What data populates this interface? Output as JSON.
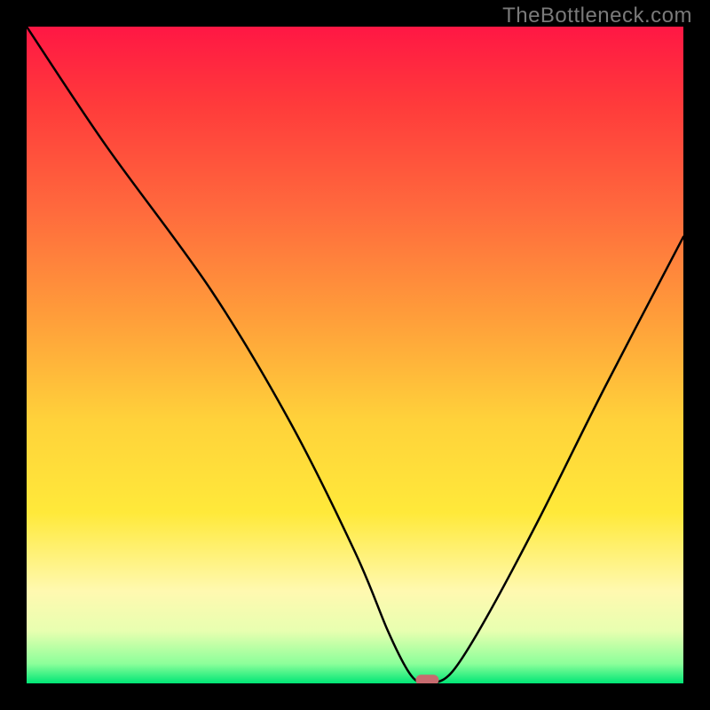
{
  "watermark": "TheBottleneck.com",
  "chart_data": {
    "type": "line",
    "title": "",
    "xlabel": "",
    "ylabel": "",
    "xlim": [
      0,
      100
    ],
    "ylim": [
      0,
      100
    ],
    "series": [
      {
        "name": "bottleneck-curve",
        "x": [
          0,
          12,
          28,
          40,
          50,
          55,
          58,
          60,
          62,
          65,
          70,
          78,
          88,
          100
        ],
        "values": [
          100,
          82,
          60,
          40,
          20,
          8,
          2,
          0,
          0,
          2,
          10,
          25,
          45,
          68
        ]
      }
    ],
    "marker": {
      "x": 61,
      "y": 0.5
    },
    "gradient_stops": [
      {
        "offset": 0.0,
        "color": "#ff1744"
      },
      {
        "offset": 0.12,
        "color": "#ff3b3b"
      },
      {
        "offset": 0.28,
        "color": "#ff6a3d"
      },
      {
        "offset": 0.45,
        "color": "#ffa03a"
      },
      {
        "offset": 0.6,
        "color": "#ffd23a"
      },
      {
        "offset": 0.74,
        "color": "#ffe93a"
      },
      {
        "offset": 0.86,
        "color": "#fff9b0"
      },
      {
        "offset": 0.92,
        "color": "#e8ffb0"
      },
      {
        "offset": 0.97,
        "color": "#8cff9a"
      },
      {
        "offset": 1.0,
        "color": "#00e676"
      }
    ],
    "marker_color": "#c76b6f"
  }
}
